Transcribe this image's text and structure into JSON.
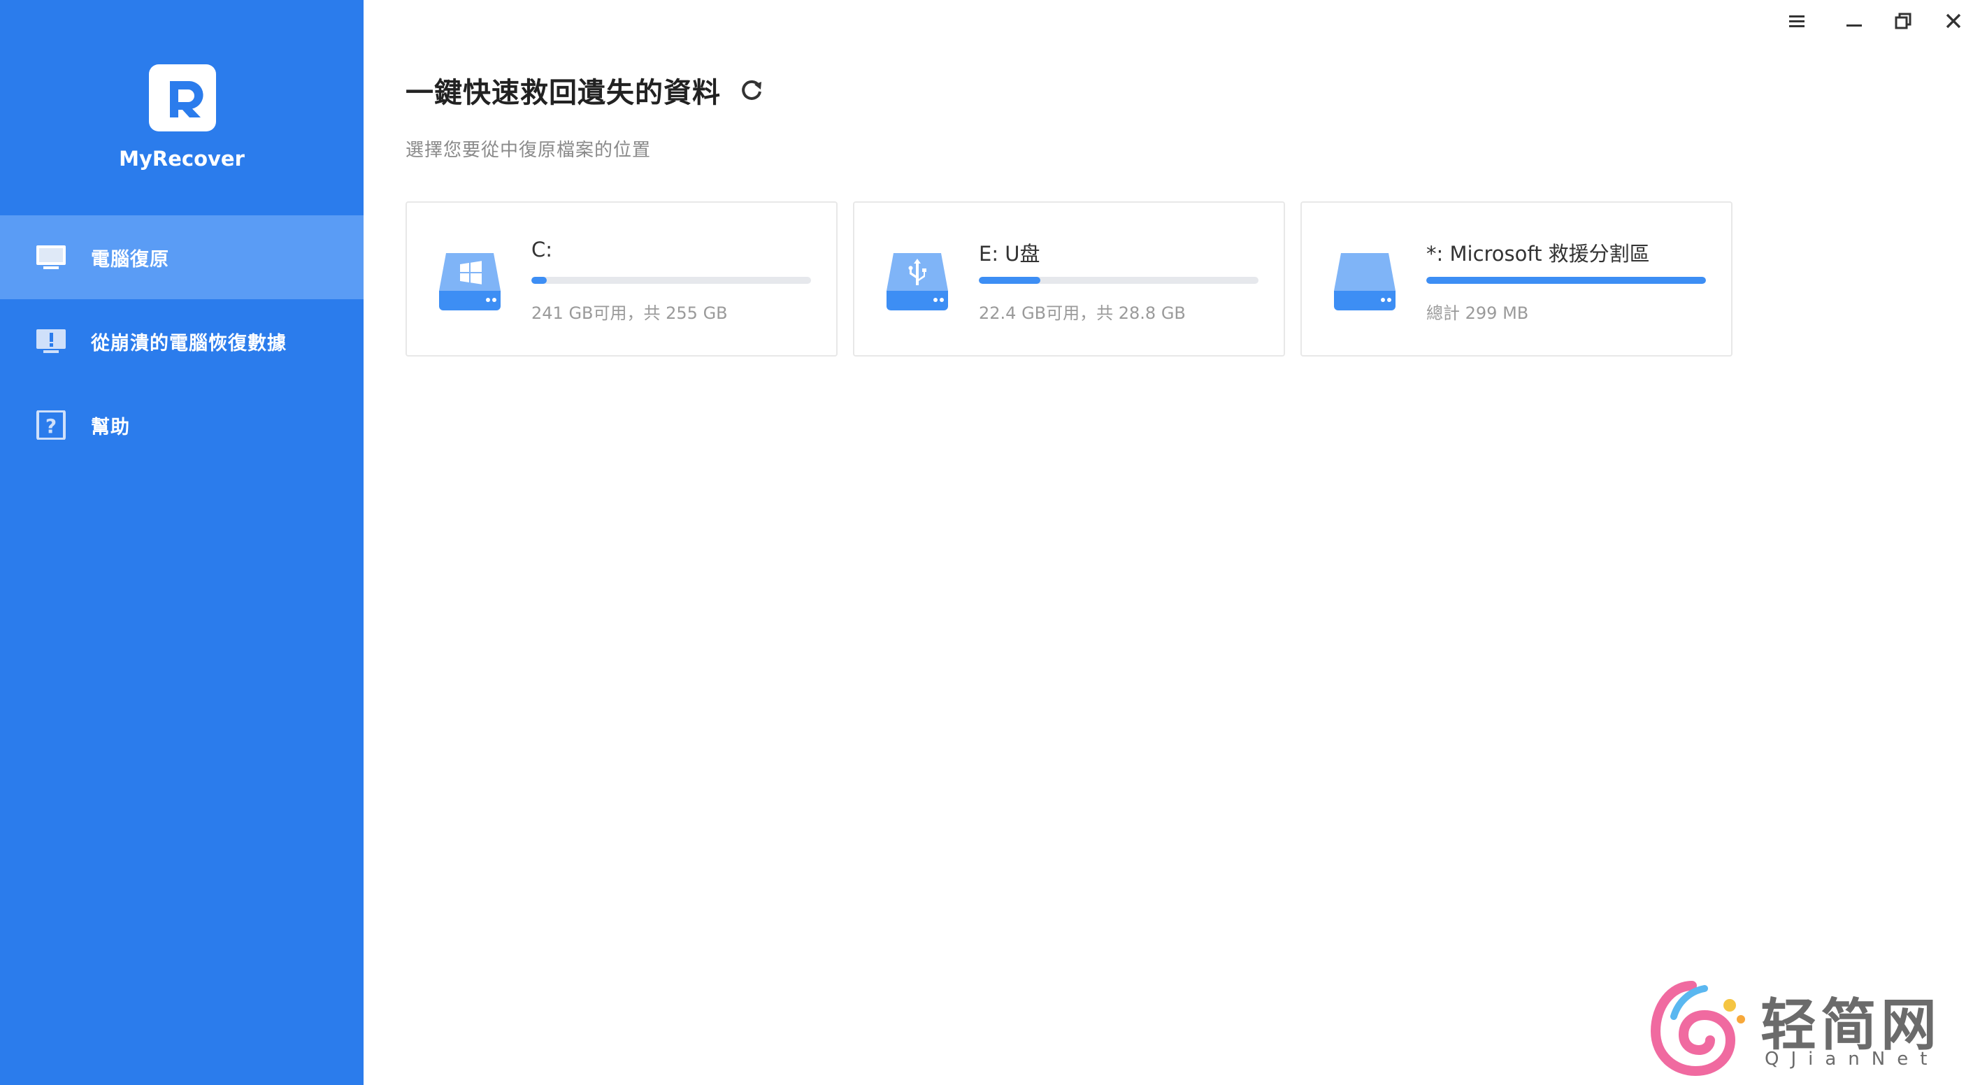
{
  "app": {
    "brand": "MyRecover"
  },
  "colors": {
    "sidebar": "#2b7cec",
    "sidebar_active": "#5a9cf5",
    "accent": "#3d8ef4"
  },
  "window_controls": {
    "menu_icon": "hamburger-icon",
    "minimize_icon": "minimize-icon",
    "restore_icon": "restore-icon",
    "close_icon": "close-icon"
  },
  "sidebar": {
    "items": [
      {
        "label": "電腦復原",
        "icon": "monitor-icon",
        "active": true
      },
      {
        "label": "從崩潰的電腦恢復數據",
        "icon": "monitor-alert-icon",
        "active": false
      },
      {
        "label": "幫助",
        "icon": "help-icon",
        "active": false
      }
    ]
  },
  "main": {
    "title": "一鍵快速救回遺失的資料",
    "subtitle": "選擇您要從中復原檔案的位置",
    "drives": [
      {
        "name": "C:",
        "info": "241 GB可用，共 255 GB",
        "used_fraction": 0.055,
        "icon": "windows-drive-icon"
      },
      {
        "name": "E: U盘",
        "info": "22.4 GB可用，共 28.8 GB",
        "used_fraction": 0.22,
        "icon": "usb-drive-icon"
      },
      {
        "name": "*: Microsoft 救援分割區",
        "info": "總計 299 MB",
        "used_fraction": 1.0,
        "icon": "partition-drive-icon"
      }
    ]
  },
  "watermark": {
    "title": "轻简网",
    "subtitle": "QJianNet"
  }
}
